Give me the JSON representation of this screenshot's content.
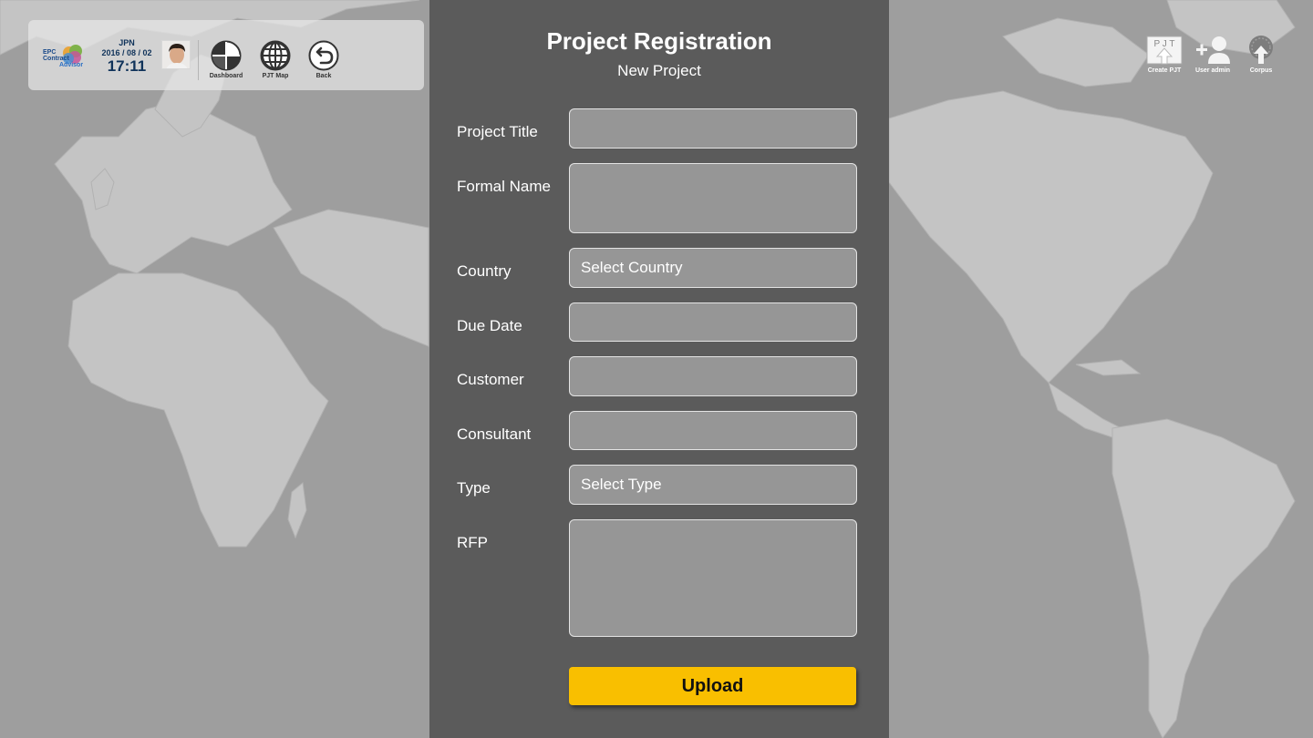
{
  "toolbar": {
    "logo": {
      "line1": "EPC",
      "line2": "Contract",
      "line3": "Advisor"
    },
    "clock": {
      "timezone": "JPN",
      "date": "2016 / 08 / 02",
      "time": "17:11"
    },
    "buttons": [
      {
        "label": "Dashboard",
        "icon": "dashboard-icon"
      },
      {
        "label": "PJT Map",
        "icon": "globe-icon"
      },
      {
        "label": "Back",
        "icon": "back-arrow-icon"
      }
    ]
  },
  "top_actions": [
    {
      "label": "Create PJT",
      "icon": "create-project-icon",
      "badge": "P J T"
    },
    {
      "label": "User admin",
      "icon": "add-user-icon"
    },
    {
      "label": "Corpus",
      "icon": "corpus-upload-icon"
    }
  ],
  "form": {
    "title": "Project Registration",
    "subtitle": "New Project",
    "fields": [
      {
        "label": "Project Title",
        "value": "",
        "placeholder": ""
      },
      {
        "label": "Formal Name",
        "value": "",
        "placeholder": ""
      },
      {
        "label": "Country",
        "value": "Select Country"
      },
      {
        "label": "Due Date",
        "value": "",
        "placeholder": ""
      },
      {
        "label": "Customer",
        "value": "",
        "placeholder": ""
      },
      {
        "label": "Consultant",
        "value": "",
        "placeholder": ""
      },
      {
        "label": "Type",
        "value": "Select Type"
      },
      {
        "label": "RFP",
        "value": "",
        "placeholder": ""
      }
    ],
    "upload_label": "Upload"
  },
  "colors": {
    "accent": "#f9bf00",
    "panel": "#484848",
    "land": "#c6c6c6",
    "water": "#9c9c9c",
    "clock_text": "#10335a"
  }
}
